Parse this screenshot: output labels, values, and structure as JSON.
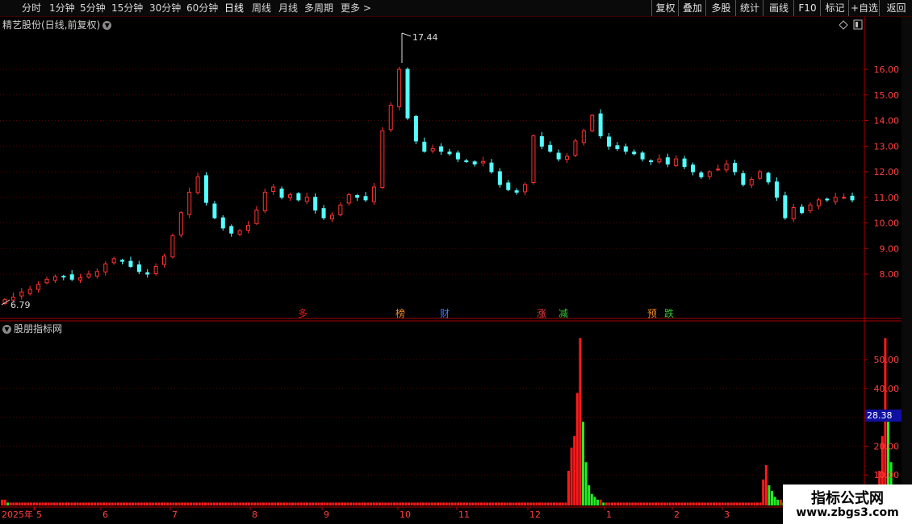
{
  "toolbar": {
    "periods": [
      "分时",
      "1分钟",
      "5分钟",
      "15分钟",
      "30分钟",
      "60分钟",
      "日线",
      "周线",
      "月线",
      "多周期",
      "更多 >"
    ],
    "active_period": "日线",
    "right_buttons": [
      "复权",
      "叠加",
      "多股",
      "统计",
      "画线",
      "F10",
      "标记",
      "+自选",
      "返回"
    ]
  },
  "main_panel": {
    "title": "精艺股份(日线,前复权)",
    "price_ticks": [
      "16.00",
      "15.00",
      "14.00",
      "13.00",
      "12.00",
      "11.00",
      "10.00",
      "9.00",
      "8.00"
    ],
    "high_label": "17.44",
    "low_label": "6.79",
    "markers": [
      {
        "text": "多",
        "color": "#e02020"
      },
      {
        "text": "榜",
        "color": "#f08c28"
      },
      {
        "text": "财",
        "color": "#3c78ff"
      },
      {
        "text": "涨",
        "color": "#f03c3c"
      },
      {
        "text": "减",
        "color": "#32c832"
      },
      {
        "text": "预",
        "color": "#f08c28"
      },
      {
        "text": "跌",
        "color": "#32c832"
      }
    ]
  },
  "indicator_panel": {
    "title": "股朋指标网",
    "ticks": [
      "50.00",
      "40.00",
      "30.00",
      "20.00",
      "10.00"
    ],
    "current_value": "28.38"
  },
  "date_axis": {
    "labels": [
      "2025年",
      "5",
      "6",
      "7",
      "8",
      "9",
      "10",
      "11",
      "12",
      "1",
      "2",
      "3"
    ]
  },
  "watermark": {
    "line1": "指标公式网",
    "line2": "www.zbgs3.com"
  },
  "colors": {
    "up": "#ff3232",
    "down": "#54ffff",
    "bar_up": "#ff1a1a",
    "bar_down": "#22ee22",
    "grid": "#5a0000",
    "axis": "#aa0000",
    "value_box": "#1010a0"
  },
  "chart_data": [
    {
      "type": "candlestick",
      "series": [
        {
          "values": [
            7.0,
            7.1,
            7.3,
            7.4,
            7.6,
            7.8,
            7.9,
            7.9,
            7.8,
            7.85,
            8.0,
            8.1,
            8.4,
            8.6,
            8.5,
            8.3,
            8.1,
            8.0,
            8.3,
            8.7,
            9.5,
            10.4,
            11.2,
            11.8,
            10.8,
            10.2,
            9.8,
            9.6,
            9.7,
            9.9,
            10.5,
            11.2,
            11.4,
            11.0,
            11.1,
            10.9,
            11.0,
            10.5,
            10.2,
            10.3,
            10.7,
            11.1,
            11.0,
            10.9,
            11.4,
            13.6,
            14.6,
            16.0,
            14.1,
            13.2,
            12.8,
            12.9,
            12.8,
            12.7,
            12.5,
            12.4,
            12.3,
            12.4,
            12.0,
            11.5,
            11.3,
            11.2,
            11.5,
            13.4,
            13.0,
            12.8,
            12.5,
            12.6,
            13.2,
            13.6,
            14.2,
            13.4,
            13.0,
            12.9,
            12.8,
            12.7,
            12.5,
            12.4,
            12.5,
            12.3,
            12.5,
            12.2,
            12.0,
            11.8,
            12.0,
            12.1,
            12.3,
            12.0,
            11.5,
            11.7,
            12.0,
            11.6,
            11.0,
            10.2,
            10.6,
            10.4,
            10.7,
            10.9,
            10.9,
            11.0,
            11.0,
            10.9
          ]
        }
      ],
      "ylim": [
        6.79,
        17.44
      ]
    },
    {
      "type": "bar",
      "series": [
        {
          "values": [
            2,
            2,
            1,
            1,
            1,
            1,
            1,
            1,
            1,
            1,
            1,
            1,
            1,
            1,
            1,
            1,
            1,
            1,
            1,
            1,
            1,
            1,
            1,
            1,
            1,
            1,
            1,
            1,
            1,
            1,
            1,
            1,
            1,
            1,
            1,
            1,
            1,
            1,
            1,
            1,
            1,
            1,
            1,
            1,
            1,
            1,
            1,
            1,
            1,
            1,
            1,
            1,
            1,
            1,
            1,
            1,
            1,
            1,
            1,
            1,
            1,
            1,
            1,
            1,
            1,
            1,
            1,
            1,
            1,
            1,
            1,
            1,
            1,
            1,
            1,
            1,
            1,
            1,
            1,
            1,
            1,
            1,
            1,
            1,
            1,
            1,
            1,
            1,
            1,
            1,
            1,
            1,
            1,
            1,
            1,
            1,
            1,
            1,
            1,
            1,
            1,
            1,
            1,
            1,
            1,
            1,
            1,
            1,
            1,
            1,
            1,
            1,
            1,
            1,
            1,
            1,
            1,
            1,
            1,
            1,
            1,
            1,
            1,
            1,
            1,
            1,
            1,
            1,
            1,
            1,
            1,
            1,
            1,
            1,
            1,
            1,
            1,
            1,
            1,
            1,
            1,
            1,
            1,
            1,
            1,
            1,
            1,
            1,
            1,
            1,
            1,
            1,
            1,
            1,
            1,
            1,
            1,
            1,
            1,
            1,
            1,
            1,
            1,
            1,
            1,
            1,
            1,
            1,
            1,
            1,
            1,
            1,
            1,
            1,
            1,
            1,
            1,
            1,
            1,
            1,
            1,
            1,
            1,
            1,
            1,
            1,
            1,
            1,
            1,
            1,
            1,
            1,
            1,
            1,
            1,
            12,
            20,
            24,
            39,
            58,
            29,
            15,
            7,
            4,
            3,
            2,
            2,
            1,
            1,
            1,
            1,
            1,
            1,
            1,
            1,
            1,
            1,
            1,
            1,
            1,
            1,
            1,
            1,
            1,
            1,
            1,
            1,
            1,
            1,
            1,
            1,
            1,
            1,
            1,
            1,
            1,
            1,
            1,
            1,
            1,
            1,
            1,
            1,
            1,
            1,
            1,
            1,
            1,
            1,
            1,
            1,
            1,
            1,
            1,
            1,
            1,
            1,
            1,
            1,
            1,
            1,
            1,
            9,
            14,
            7,
            5,
            3,
            2,
            2,
            1,
            1,
            1,
            1,
            1,
            1,
            1,
            1,
            1,
            1,
            1,
            1,
            1,
            1,
            1,
            1,
            1,
            1,
            1,
            1,
            1,
            1,
            1,
            1,
            1,
            1,
            1,
            1,
            1,
            1,
            1,
            1,
            1,
            12,
            24,
            58,
            29,
            15,
            7
          ]
        }
      ],
      "ylim": [
        0,
        60
      ]
    }
  ]
}
